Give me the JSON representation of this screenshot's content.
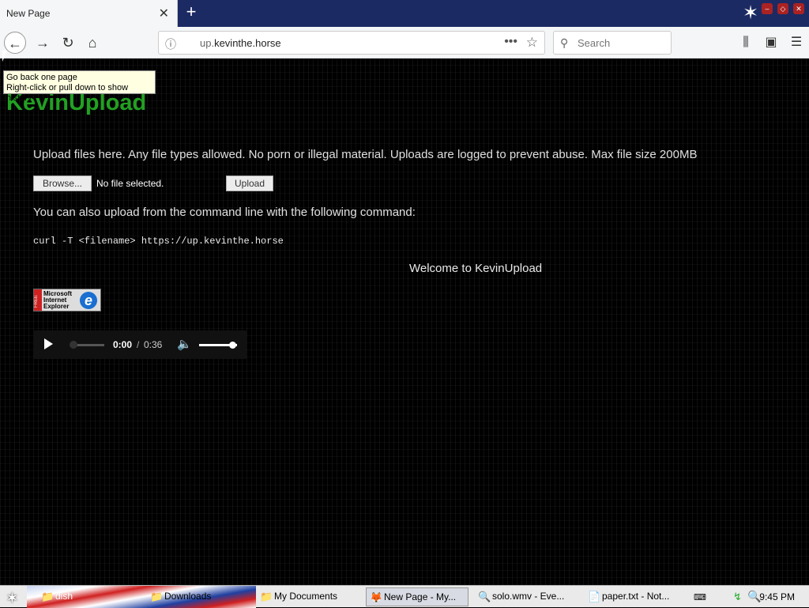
{
  "browser": {
    "tab_title": "New Page",
    "tab_close": "✕",
    "new_tab": "+",
    "url_domain": "up.",
    "url_rest": "kevinthe.horse",
    "url_dots": "•••",
    "search_placeholder": "Search",
    "tooltip_line1": "Go back one page",
    "tooltip_line2": "Right-click or pull down to show history"
  },
  "page": {
    "logo": "KevinUpload",
    "description": "Upload files here. Any file types allowed. No porn or illegal material. Uploads are logged to prevent abuse. Max file size 200MB",
    "browse_label": "Browse...",
    "no_file": "No file selected.",
    "upload_label": "Upload",
    "cmd_intro": "You can also upload from the command line with the following command:",
    "cmd": "curl -T <filename> https://up.kevinthe.horse",
    "welcome": "Welcome to KevinUpload",
    "ie_badge_free": "FREE",
    "ie_badge_line1": "Microsoft",
    "ie_badge_line2": "Internet",
    "ie_badge_line3": "Explorer",
    "audio": {
      "current": "0:00",
      "sep": "/",
      "duration": "0:36",
      "progress": 0.0,
      "volume": 0.85
    }
  },
  "taskbar": {
    "items": [
      {
        "label": "dish",
        "icon": "folder-icon"
      },
      {
        "label": "Downloads",
        "icon": "folder-icon"
      },
      {
        "label": "My Documents",
        "icon": "folder-icon"
      },
      {
        "label": "New Page - My...",
        "icon": "browser-icon",
        "active": true
      },
      {
        "label": "solo.wmv - Eve...",
        "icon": "search-icon"
      },
      {
        "label": "paper.txt - Not...",
        "icon": "notepad-icon"
      }
    ],
    "time": "9:45 PM"
  }
}
